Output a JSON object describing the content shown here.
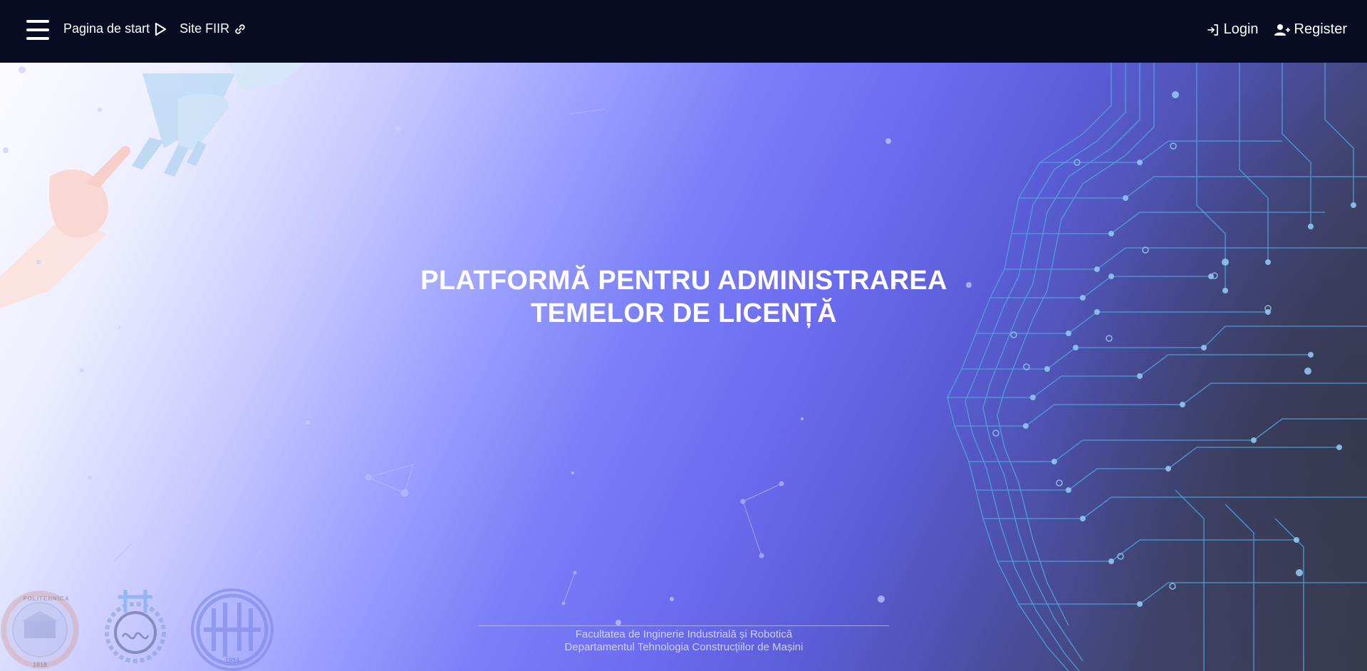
{
  "navbar": {
    "menu_icon": "hamburger-menu-icon",
    "home_label": "Pagina de start",
    "home_icon": "play-triangle-icon",
    "site_label": "Site FIIR",
    "site_icon": "link-icon",
    "login_label": "Login",
    "login_icon": "sign-in-icon",
    "register_label": "Register",
    "register_icon": "user-plus-icon"
  },
  "hero": {
    "title_line1": "PLATFORMĂ PENTRU ADMINISTRAREA",
    "title_line2": "TEMELOR DE LICENȚĂ",
    "footer_line1": "Facultatea de Inginerie Industrială și Robotică",
    "footer_line2": "Departamentul Tehnologia Construcțiilor de Mașini"
  },
  "logos": {
    "upb_text_top": "POLITEHNICA",
    "upb_year": "1818",
    "tcm_year": "1954"
  },
  "colors": {
    "navbar_bg": "#070c23",
    "accent_violet": "#6c6cf0",
    "circuit_blue": "#4da6e0"
  }
}
